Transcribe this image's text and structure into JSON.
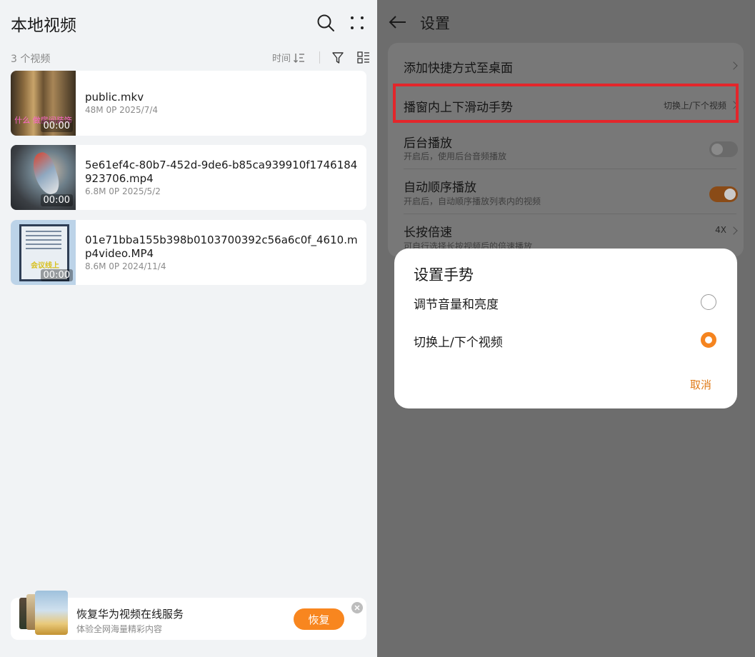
{
  "left": {
    "title": "本地视频",
    "count": "3 个视频",
    "sort_label": "时间",
    "videos": [
      {
        "title": "public.mkv",
        "meta": "48M  0P  2025/7/4",
        "duration": "00:00",
        "caption": "什么 做房间装饰"
      },
      {
        "title": "5e61ef4c-80b7-452d-9de6-b85ca939910f1746184923706.mp4",
        "meta": "6.8M  0P  2025/5/2",
        "duration": "00:00"
      },
      {
        "title": "01e71bba155b398b0103700392c56a6c0f_4610.mp4video.MP4",
        "meta": "8.6M  0P  2024/11/4",
        "duration": "00:00",
        "caption": "会议线上"
      }
    ],
    "banner": {
      "title": "恢复华为视频在线服务",
      "subtitle": "体验全网海量精彩内容",
      "button": "恢复"
    }
  },
  "right": {
    "title": "设置",
    "rows": [
      {
        "label": "添加快捷方式至桌面"
      },
      {
        "label": "播窗内上下滑动手势",
        "value": "切换上/下个视频"
      },
      {
        "label": "后台播放",
        "sub": "开启后，使用后台音频播放",
        "toggle": false
      },
      {
        "label": "自动顺序播放",
        "sub": "开启后，自动顺序播放列表内的视频",
        "toggle": true
      },
      {
        "label": "长按倍速",
        "sub": "可自行选择长按视频后的倍速播放",
        "value": "4X"
      }
    ],
    "dialog": {
      "title": "设置手势",
      "options": [
        {
          "label": "调节音量和亮度",
          "selected": false
        },
        {
          "label": "切换上/下个视频",
          "selected": true
        }
      ],
      "cancel": "取消"
    }
  },
  "colors": {
    "accent": "#f5841f",
    "highlight": "#e3262b",
    "overlay": "#6d6d6d"
  }
}
